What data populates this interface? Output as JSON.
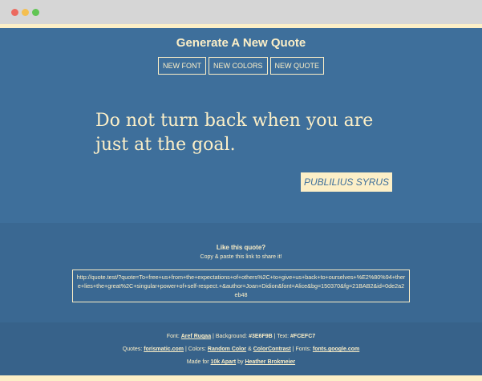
{
  "title": "Generate A New Quote",
  "buttons": {
    "new_font": "NEW FONT",
    "new_colors": "NEW COLORS",
    "new_quote": "NEW QUOTE"
  },
  "quote": {
    "text": "Do not turn back when you are just at the goal.",
    "author": "PUBLILIUS SYRUS"
  },
  "share": {
    "heading": "Like this quote?",
    "subtext": "Copy & paste this link to share it!",
    "link": "http://quote.test/?quote=To+free+us+from+the+expectations+of+others%2C+to+give+us+back+to+ourselves+%E2%80%94+there+lies+the+great%2C+singular+power+of+self-respect.+&author=Joan+Didion&font=Alice&bg=150370&fg=21BAB2&id=0de2a2eb48"
  },
  "footer": {
    "line1": {
      "font_label": "Font:",
      "font_value": "Aref Ruqaa",
      "sep1": "|",
      "bg_label": "Background:",
      "bg_value": "#3E6F9B",
      "sep2": "|",
      "text_label": "Text:",
      "text_value": "#FCEFC7"
    },
    "line2": {
      "quotes_label": "Quotes:",
      "quotes_link": "forismatic.com",
      "sep1": "|",
      "colors_label": "Colors:",
      "colors_link1": "Random Color",
      "amp": "&",
      "colors_link2": "ColorContrast",
      "sep2": "|",
      "fonts_label": "Fonts:",
      "fonts_link": "fonts.google.com"
    },
    "line3": {
      "made_label": "Made for",
      "made_link": "10k Apart",
      "by_label": "by",
      "by_link": "Heather Brokmeier"
    }
  },
  "colors": {
    "background": "#3E6F9B",
    "text": "#FCEFC7"
  }
}
